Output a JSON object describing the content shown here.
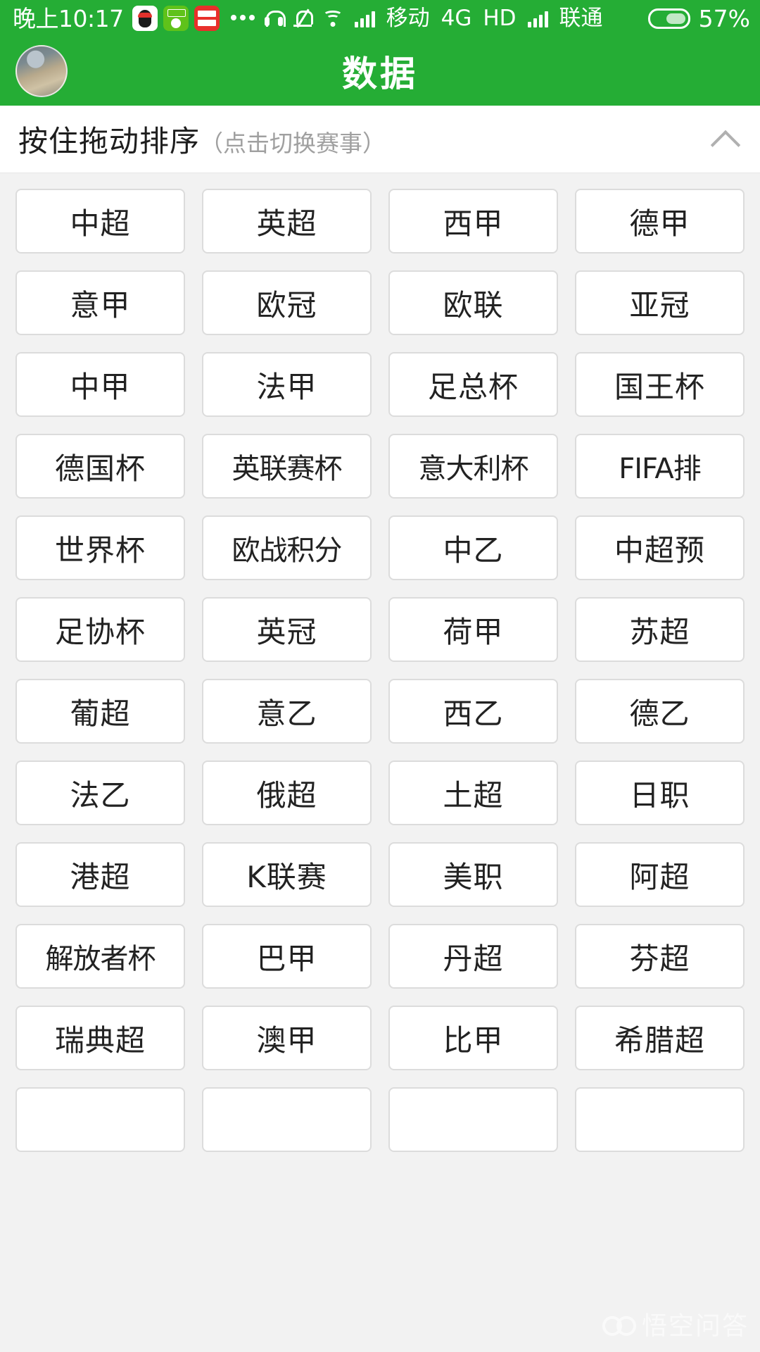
{
  "status_bar": {
    "clock": "晚上10:17",
    "app_icons": [
      "qq-icon",
      "soccer-app-icon",
      "toutiao-icon"
    ],
    "overflow": "...",
    "icons": [
      "headset-icon",
      "bell-muted-icon",
      "wifi-icon",
      "signal-bars-icon"
    ],
    "carrier_primary": "移动",
    "network_type": "4G",
    "hd_label": "HD",
    "carrier_secondary": "联通",
    "battery_percent": "57%",
    "accent_color": "#25ad35",
    "text_color": "#ffffff"
  },
  "header": {
    "title": "数据",
    "avatar_name": "user-avatar",
    "background_color": "#25ad35"
  },
  "sort_bar": {
    "main_label": "按住拖动排序",
    "sub_label": "（点击切换赛事）",
    "collapse_icon": "chevron-up-icon"
  },
  "grid": {
    "columns": 4,
    "chip_background": "#ffffff",
    "chip_border": "#dcdcdc",
    "items": [
      "中超",
      "英超",
      "西甲",
      "德甲",
      "意甲",
      "欧冠",
      "欧联",
      "亚冠",
      "中甲",
      "法甲",
      "足总杯",
      "国王杯",
      "德国杯",
      "英联赛杯",
      "意大利杯",
      "FIFA排",
      "世界杯",
      "欧战积分",
      "中乙",
      "中超预",
      "足协杯",
      "英冠",
      "荷甲",
      "苏超",
      "葡超",
      "意乙",
      "西乙",
      "德乙",
      "法乙",
      "俄超",
      "土超",
      "日职",
      "港超",
      "K联赛",
      "美职",
      "阿超",
      "解放者杯",
      "巴甲",
      "丹超",
      "芬超",
      "瑞典超",
      "澳甲",
      "比甲",
      "希腊超",
      "",
      "",
      "",
      ""
    ]
  },
  "watermark": {
    "text": "悟空问答",
    "logo": "wukong-logo-icon"
  }
}
